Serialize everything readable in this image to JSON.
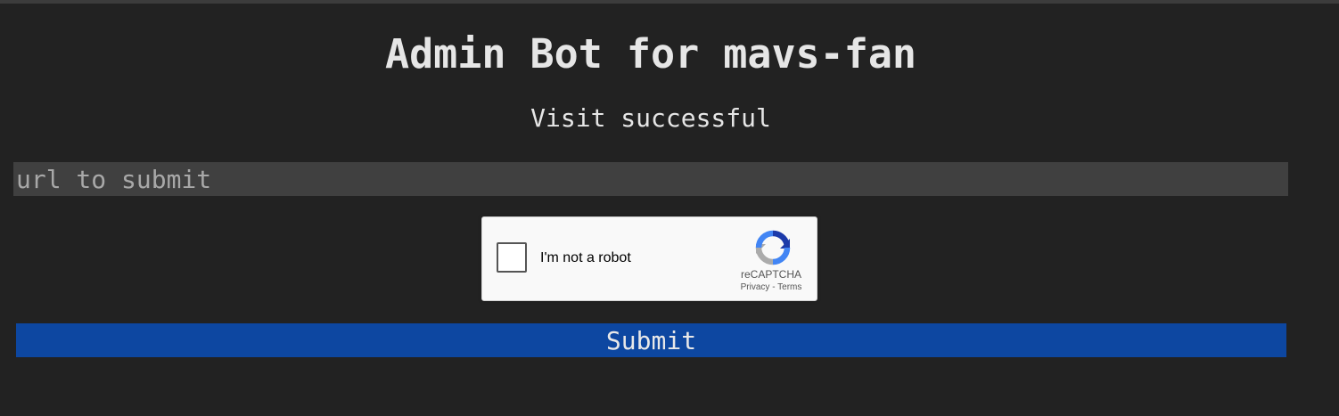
{
  "page": {
    "title": "Admin Bot for mavs-fan",
    "status": "Visit successful"
  },
  "form": {
    "url_placeholder": "url to submit",
    "url_value": "",
    "submit_label": "Submit"
  },
  "captcha": {
    "label": "I'm not a robot",
    "brand": "reCAPTCHA",
    "privacy_link": "Privacy",
    "separator": "-",
    "terms_link": "Terms",
    "checked": false
  },
  "colors": {
    "background": "#222222",
    "input_background": "#404040",
    "submit_background": "#0d47a1",
    "captcha_background": "#f9f9f9"
  },
  "icons": {
    "captcha_logo": "recaptcha-logo-icon"
  }
}
